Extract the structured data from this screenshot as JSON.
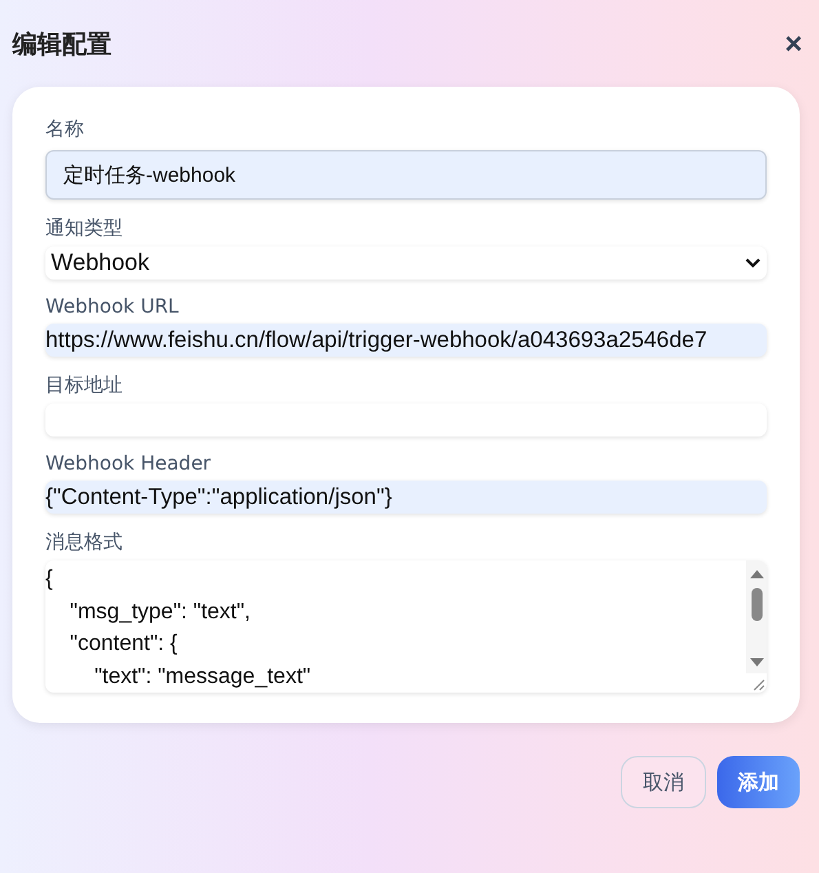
{
  "dialog": {
    "title": "编辑配置",
    "close": "×"
  },
  "fields": [
    {
      "kind": "input",
      "label": "名称",
      "value": "定时任务-webhook",
      "highlighted": true
    },
    {
      "kind": "select",
      "label": "通知类型",
      "value": "Webhook"
    },
    {
      "kind": "input",
      "label": "Webhook URL",
      "value": "https://www.feishu.cn/flow/api/trigger-webhook/a043693a2546de7",
      "highlighted": true
    },
    {
      "kind": "input",
      "label": "目标地址",
      "highlighted": false
    },
    {
      "kind": "input",
      "label": "Webhook Header",
      "value": "{\"Content-Type\":\"application/json\"}",
      "highlighted": true
    },
    {
      "kind": "textarea",
      "label": "消息格式",
      "lines": [
        "{",
        "    \"msg_type\": \"text\",",
        "    \"content\": {",
        "        \"text\": \"message_text\""
      ]
    }
  ],
  "buttons": [
    {
      "label": "取消",
      "kind": "secondary"
    },
    {
      "label": "添加",
      "kind": "primary"
    }
  ]
}
